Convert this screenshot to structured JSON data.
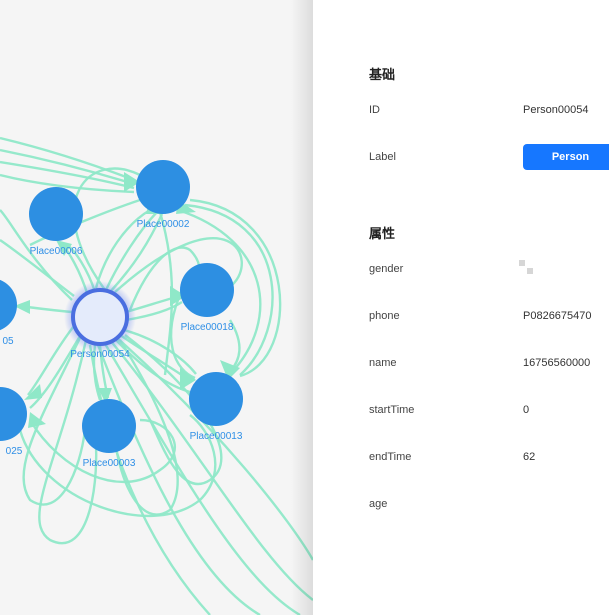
{
  "graph": {
    "nodes": [
      {
        "id": "Person00054",
        "label": "Person00054",
        "selected": true
      },
      {
        "id": "Place00002",
        "label": "Place00002"
      },
      {
        "id": "Place00006",
        "label": "Place00006"
      },
      {
        "id": "Place00018",
        "label": "Place00018"
      },
      {
        "id": "Place00013",
        "label": "Place00013"
      },
      {
        "id": "Place00003",
        "label": "Place00003"
      },
      {
        "id": "partial-05",
        "label": "05"
      },
      {
        "id": "partial-025",
        "label": "025"
      }
    ],
    "colors": {
      "node": "#2d8fe2",
      "selected_node": "#e4ebfb",
      "selected_stroke": "#4a6ee0",
      "edge": "#8fe8c8",
      "label": "#2f8fe6"
    }
  },
  "details": {
    "basic_title": "基础",
    "id_key": "ID",
    "id_value": "Person00054",
    "label_key": "Label",
    "label_value": "Person",
    "attr_title": "属性",
    "gender_key": "gender",
    "phone_key": "phone",
    "phone_value": "P0826675470",
    "name_key": "name",
    "name_value": "16756560000",
    "startTime_key": "startTime",
    "startTime_value": "0",
    "endTime_key": "endTime",
    "endTime_value": "62",
    "age_key": "age",
    "accent_color": "#1677ff"
  }
}
